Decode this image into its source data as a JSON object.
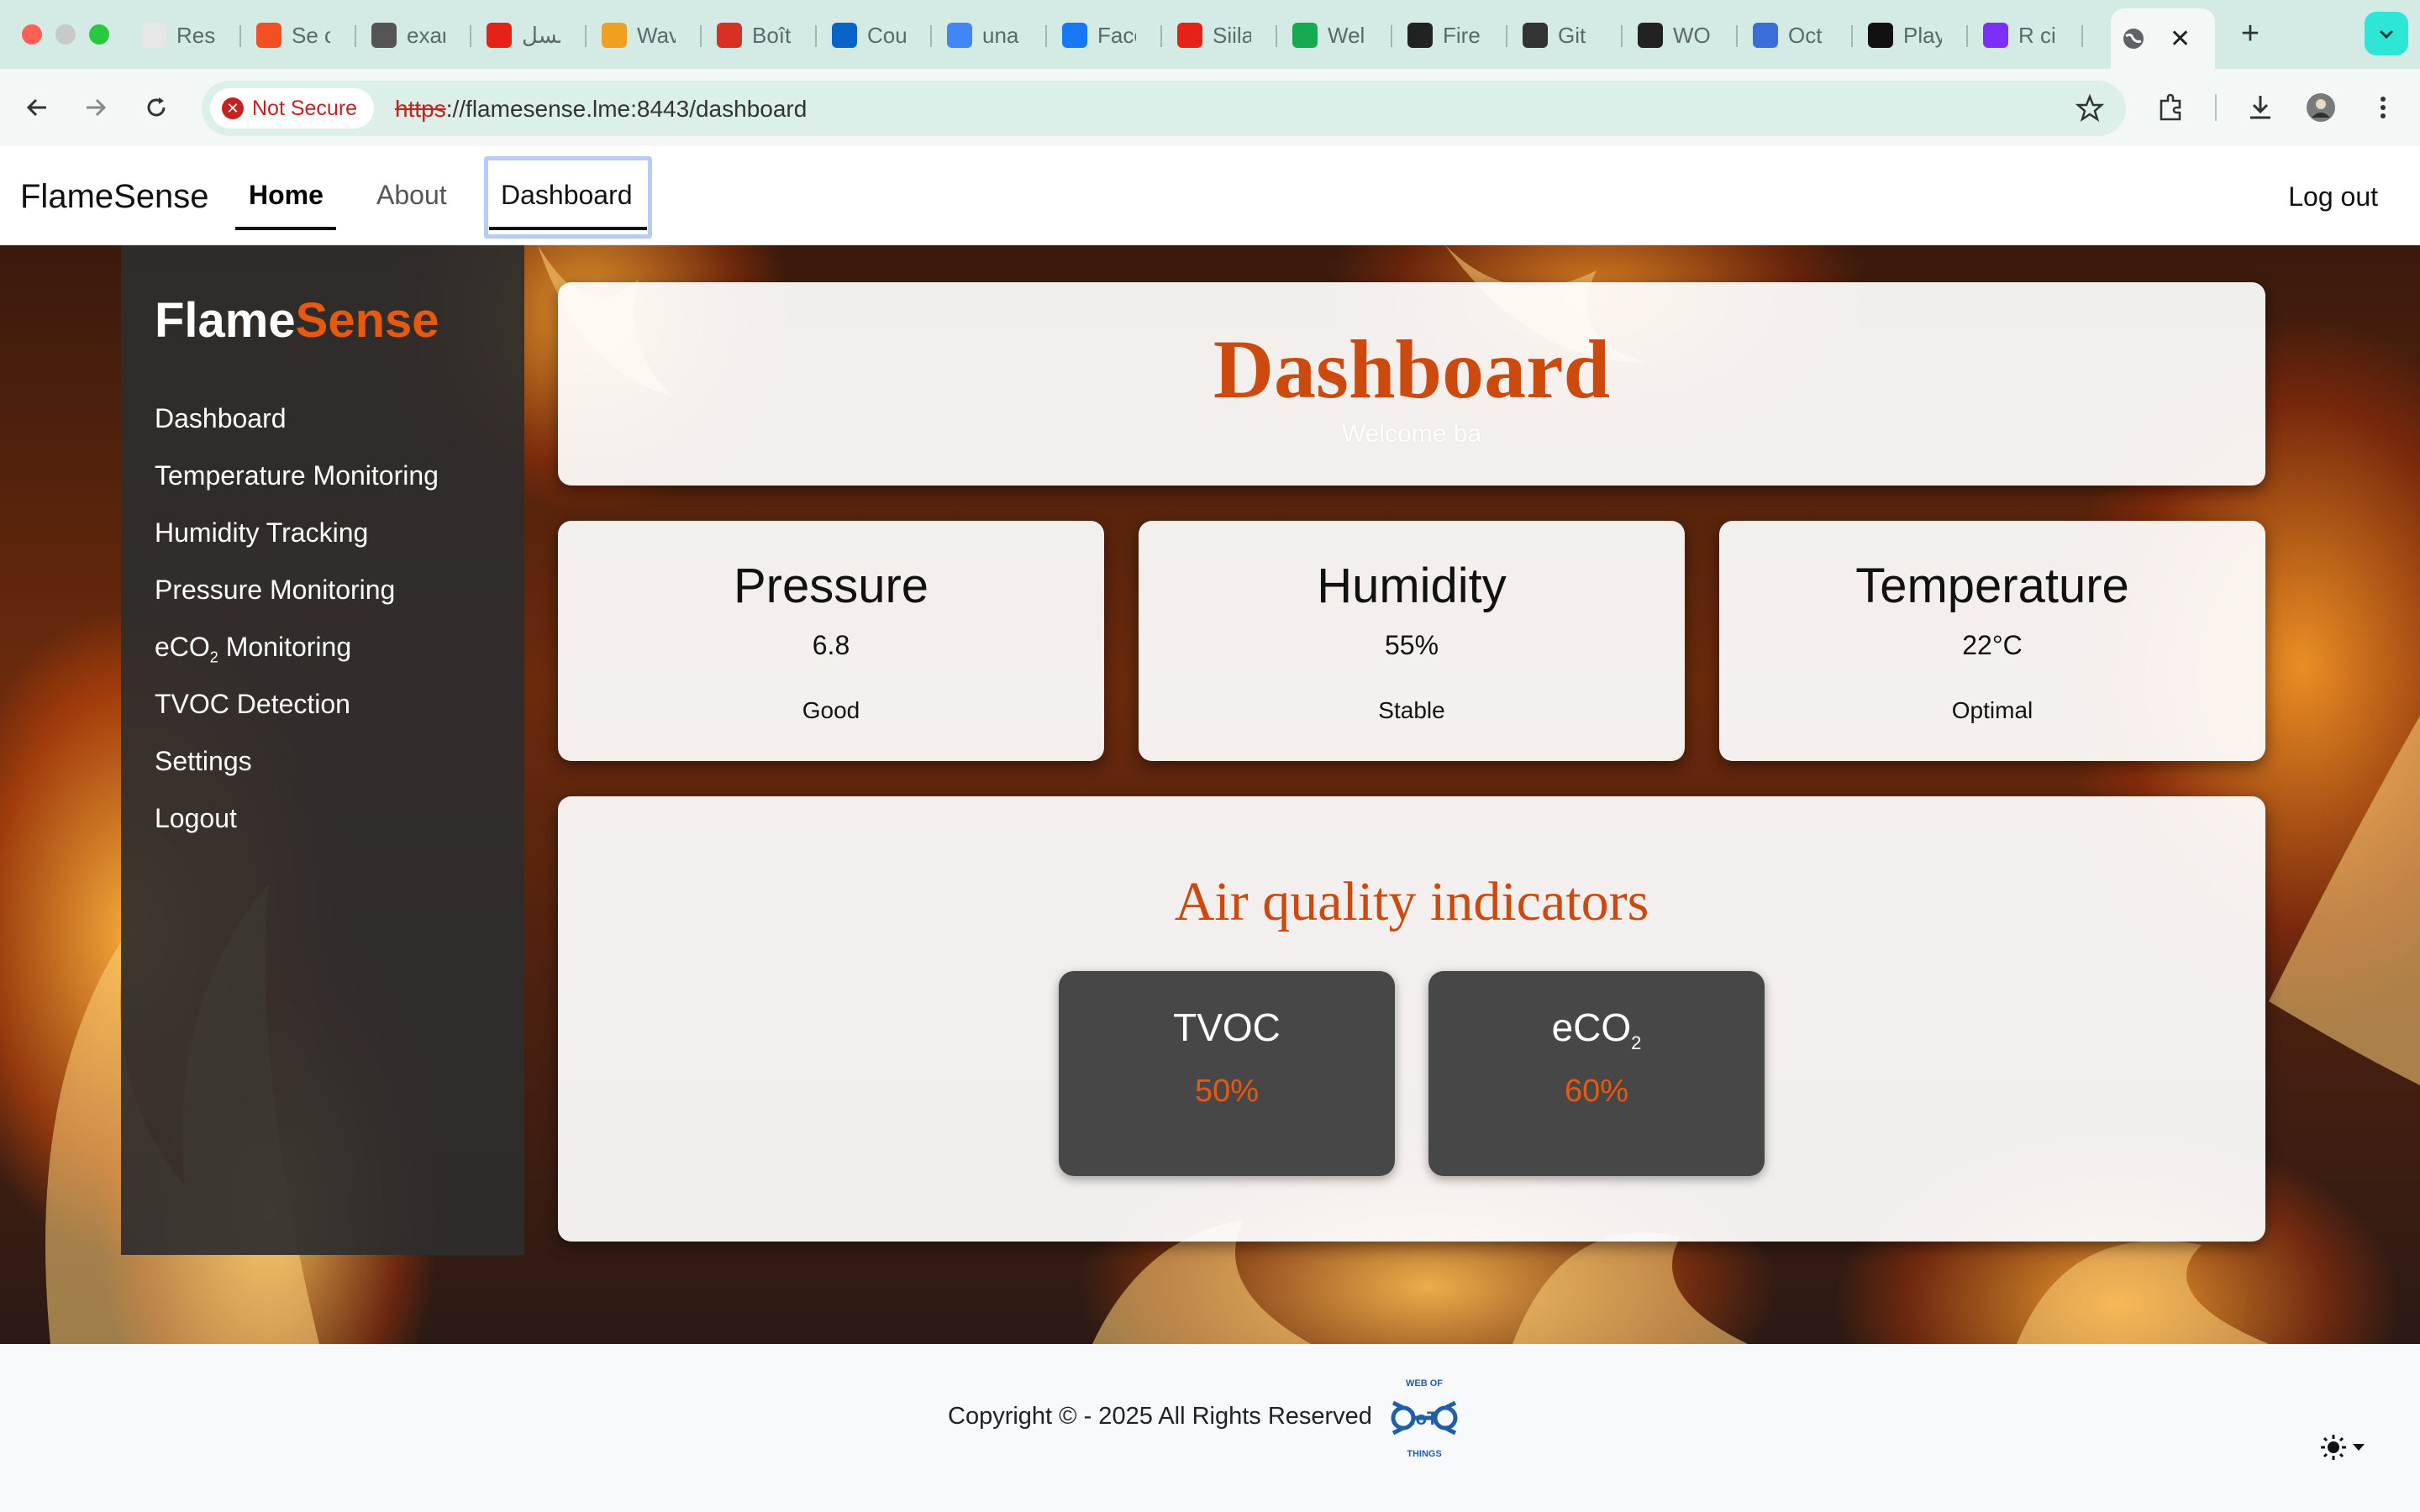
{
  "browser": {
    "tabs": [
      {
        "title": "Rest",
        "icon": "gear-favicon",
        "color": "#e6e6e6"
      },
      {
        "title": "Se c",
        "icon": "microsoft-favicon",
        "color": "#f25022"
      },
      {
        "title": "exar",
        "icon": "globe-favicon",
        "color": "#555555"
      },
      {
        "title": "مسلسل",
        "icon": "youtube-favicon",
        "color": "#e62117"
      },
      {
        "title": "Wav",
        "icon": "coursera-favicon",
        "color": "#f0a020"
      },
      {
        "title": "Boît",
        "icon": "gmail-favicon",
        "color": "#d93025"
      },
      {
        "title": "Cou",
        "icon": "outlook-favicon",
        "color": "#0a64c8"
      },
      {
        "title": "una",
        "icon": "google-favicon",
        "color": "#4285f4"
      },
      {
        "title": "Face",
        "icon": "facebook-favicon",
        "color": "#1877f2"
      },
      {
        "title": "Siila",
        "icon": "youtube-favicon",
        "color": "#e62117"
      },
      {
        "title": "Wel",
        "icon": "mongodb-favicon",
        "color": "#13aa52"
      },
      {
        "title": "Fire",
        "icon": "github-favicon",
        "color": "#222222"
      },
      {
        "title": "Git",
        "icon": "openai-favicon",
        "color": "#333333"
      },
      {
        "title": "WO",
        "icon": "github-favicon",
        "color": "#222222"
      },
      {
        "title": "Oct",
        "icon": "github-copilot-favicon",
        "color": "#3b6ed8"
      },
      {
        "title": "Play",
        "icon": "mistral-favicon",
        "color": "#111111"
      },
      {
        "title": "R ci",
        "icon": "bootstrap-favicon",
        "color": "#7b2ff7"
      }
    ],
    "security_label": "Not Secure",
    "url_scheme": "https",
    "url_rest": "://flamesense.lme:8443/dashboard"
  },
  "site": {
    "brand": "FlameSense",
    "nav": {
      "home": "Home",
      "about": "About",
      "dashboard": "Dashboard",
      "logout": "Log out"
    }
  },
  "sidebar": {
    "brand_part1": "Flame",
    "brand_part2": "Sense",
    "items": [
      {
        "label": "Dashboard"
      },
      {
        "label": "Temperature Monitoring"
      },
      {
        "label": "Humidity Tracking"
      },
      {
        "label": "Pressure Monitoring"
      },
      {
        "label_prefix": "eCO",
        "label_sub": "2",
        "label_suffix": " Monitoring"
      },
      {
        "label": "TVOC Detection"
      },
      {
        "label": "Settings"
      },
      {
        "label": "Logout"
      }
    ]
  },
  "dashboard": {
    "title": "Dashboard",
    "welcome": "Welcome ba"
  },
  "stats": [
    {
      "name": "Pressure",
      "value": "6.8",
      "status": "Good"
    },
    {
      "name": "Humidity",
      "value": "55%",
      "status": "Stable"
    },
    {
      "name": "Temperature",
      "value": "22°C",
      "status": "Optimal"
    }
  ],
  "air_quality": {
    "title": "Air quality indicators",
    "tvoc": {
      "name": "TVOC",
      "value": "50%"
    },
    "eco2": {
      "name_prefix": "eCO",
      "name_sub": "2",
      "value": "60%"
    }
  },
  "footer": {
    "copyright": "Copyright ©  - 2025 All Rights Reserved",
    "logo_top": "WEB OF",
    "logo_mid": "IoT",
    "logo_bottom": "THINGS"
  },
  "colors": {
    "accent": "#e8580f",
    "title_accent": "#cc4a0d",
    "sidebar_bg": "#2e2e2e",
    "aq_box": "#474747"
  }
}
